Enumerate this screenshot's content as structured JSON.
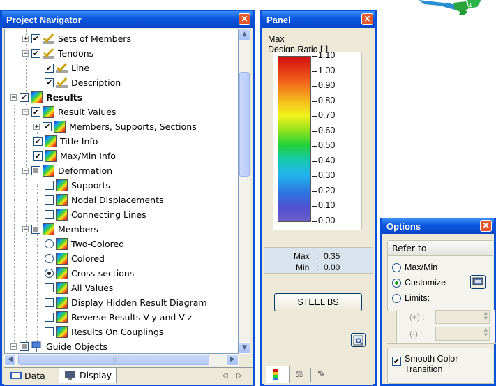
{
  "navigator": {
    "title": "Project Navigator",
    "items": [
      {
        "label": "Sets of Members"
      },
      {
        "label": "Tendons"
      },
      {
        "label": "Line"
      },
      {
        "label": "Description"
      },
      {
        "label": "Results"
      },
      {
        "label": "Result Values"
      },
      {
        "label": "Members, Supports, Sections"
      },
      {
        "label": "Title Info"
      },
      {
        "label": "Max/Min Info"
      },
      {
        "label": "Deformation"
      },
      {
        "label": "Supports"
      },
      {
        "label": "Nodal Displacements"
      },
      {
        "label": "Connecting Lines"
      },
      {
        "label": "Members"
      },
      {
        "label": "Two-Colored"
      },
      {
        "label": "Colored"
      },
      {
        "label": "Cross-sections"
      },
      {
        "label": "All Values"
      },
      {
        "label": "Display Hidden Result Diagram"
      },
      {
        "label": "Reverse Results V-y and V-z"
      },
      {
        "label": "Results On Couplings"
      },
      {
        "label": "Guide Objects"
      }
    ],
    "tabs": [
      {
        "label": "Data"
      },
      {
        "label": "Display"
      }
    ]
  },
  "panel": {
    "title": "Panel",
    "heading_line1": "Max",
    "heading_line2": "Design Ratio [-]",
    "scale": [
      "1.10",
      "1.00",
      "0.90",
      "0.80",
      "0.70",
      "0.60",
      "0.50",
      "0.40",
      "0.30",
      "0.20",
      "0.10",
      "0.00"
    ],
    "max_label": "Max",
    "max_value": "0.35",
    "min_label": "Min",
    "min_value": "0.00",
    "button": "STEEL BS"
  },
  "options": {
    "title": "Options",
    "group": "Refer to",
    "radio_maxmin": "Max/Min",
    "radio_customize": "Customize",
    "radio_limits": "Limits:",
    "plus_label": "(+) :",
    "minus_label": "(-) :",
    "smooth_line1": "Smooth Color",
    "smooth_line2": "Transition",
    "selected": "Customize"
  },
  "colors": {
    "titlebar": "#0a56e0",
    "close": "#e3582d"
  }
}
